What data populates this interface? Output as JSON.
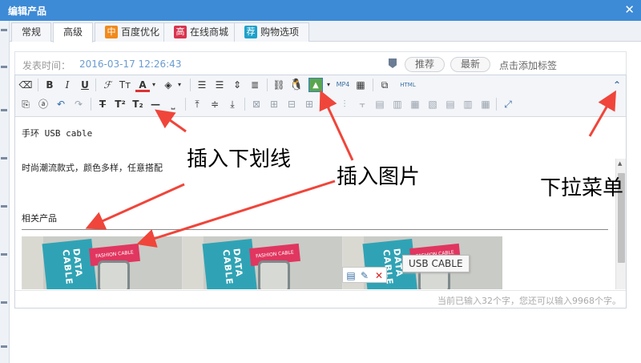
{
  "window": {
    "title": "编辑产品",
    "close": "✕"
  },
  "tabs": [
    {
      "label": "常规",
      "badge": "",
      "badge_color": ""
    },
    {
      "label": "高级",
      "badge": "",
      "badge_color": ""
    },
    {
      "label": "百度优化",
      "badge": "中",
      "badge_color": "#f08a1c"
    },
    {
      "label": "在线商城",
      "badge": "高",
      "badge_color": "#d9334f"
    },
    {
      "label": "购物选项",
      "badge": "荐",
      "badge_color": "#1ea1c9"
    }
  ],
  "meta": {
    "publish_label": "发表时间：",
    "publish_value": "2016-03-17 12:26:43",
    "recommend": "推荐",
    "newest": "最新",
    "add_tag_hint": "点击添加标签"
  },
  "toolbar": {
    "bold": "B",
    "italic": "I",
    "underline": "U",
    "font_family": "ℱ",
    "font_size": "Tт",
    "font_color": "A",
    "source": "HTML",
    "mp4": "MP4",
    "strike": "T",
    "superscript": "T²",
    "subscript": "T₂"
  },
  "content": {
    "line1": "手环 USB cable",
    "line2": "时尚潮流款式，颜色多样，任意搭配",
    "line3": "相关产品",
    "box_text": "DATA CABLE",
    "tag_text": "FASHION CABLE"
  },
  "tooltip": "USB CABLE",
  "status": "当前已输入32个字，您还可以输入9968个字。",
  "annotations": {
    "underline": "插入下划线",
    "image": "插入图片",
    "dropdown": "下拉菜单"
  },
  "colors": {
    "titlebar": "#3d8ad6",
    "arrow": "#f0453a"
  }
}
